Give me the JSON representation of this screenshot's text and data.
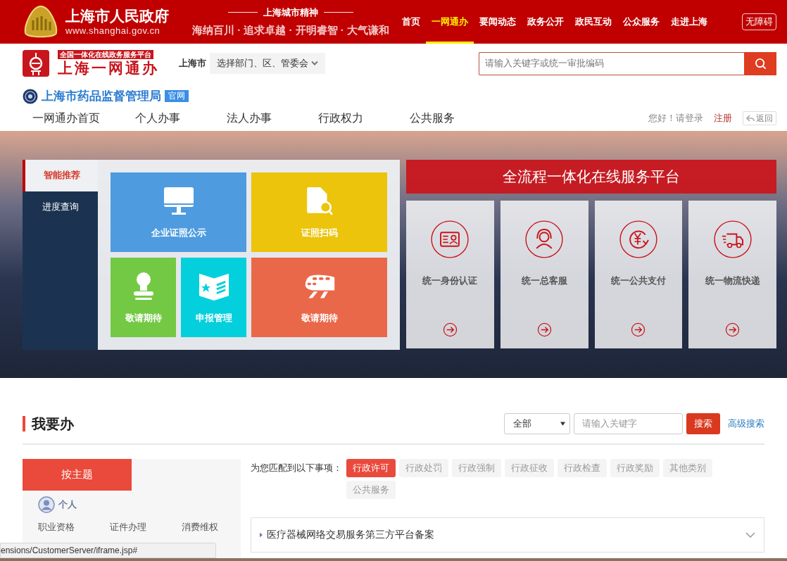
{
  "top_bar": {
    "site_title": "上海市人民政府",
    "site_url": "www.shanghai.gov.cn",
    "motto_title": "上海城市精神",
    "motto": "海纳百川 · 追求卓越 · 开明睿智 · 大气谦和",
    "nav": [
      {
        "label": "首页",
        "selected": false
      },
      {
        "label": "一网通办",
        "selected": true
      },
      {
        "label": "要闻动态",
        "selected": false
      },
      {
        "label": "政务公开",
        "selected": false
      },
      {
        "label": "政民互动",
        "selected": false
      },
      {
        "label": "公众服务",
        "selected": false
      },
      {
        "label": "走进上海",
        "selected": false
      }
    ],
    "accessibility_button": "无障碍"
  },
  "portal_header": {
    "platform_badge": "全国一体化在线政务服务平台",
    "platform_name": "上海一网通办",
    "city_label": "上海市",
    "department_select": "选择部门、区、管委会",
    "search": {
      "placeholder": "请输入关键字或统一审批编码"
    }
  },
  "agency": {
    "name": "上海市药品监督管理局",
    "badge": "官网"
  },
  "main_nav": {
    "items": [
      {
        "label": "一网通办首页",
        "selected": false
      },
      {
        "label": "个人办事",
        "selected": false
      },
      {
        "label": "法人办事",
        "selected": false
      },
      {
        "label": "行政权力",
        "selected": false
      },
      {
        "label": "公共服务",
        "selected": false
      }
    ],
    "greeting": "您好！请登录",
    "register": "注册",
    "back": "返回"
  },
  "hero": {
    "side_tabs": [
      {
        "label": "智能推荐",
        "selected": true
      },
      {
        "label": "进度查询",
        "selected": false
      }
    ],
    "tiles": [
      {
        "label": "企业证照公示",
        "color": "#4e9be0"
      },
      {
        "label": "证照扫码",
        "color": "#ebc40b"
      },
      {
        "label": "敬请期待",
        "color": "#74c944"
      },
      {
        "label": "申报管理",
        "color": "#03d0dc"
      },
      {
        "label": "敬请期待",
        "color": "#e9684a"
      }
    ],
    "banner_title": "全流程一体化在线服务平台",
    "services": [
      {
        "label": "统一身份认证"
      },
      {
        "label": "统一总客服"
      },
      {
        "label": "统一公共支付"
      },
      {
        "label": "统一物流快递"
      }
    ]
  },
  "todo": {
    "title": "我要办",
    "scope_select": "全部",
    "search": {
      "placeholder": "请输入关键字"
    },
    "search_button": "搜索",
    "advanced_search": "高级搜索",
    "theme_tab": "按主题",
    "group_label": "个人",
    "topics": [
      "职业资格",
      "证件办理",
      "消费维权"
    ],
    "matched_label": "为您匹配到以下事项：",
    "categories": [
      {
        "label": "行政许可",
        "selected": true
      },
      {
        "label": "行政处罚",
        "selected": false
      },
      {
        "label": "行政强制",
        "selected": false
      },
      {
        "label": "行政征收",
        "selected": false
      },
      {
        "label": "行政检查",
        "selected": false
      },
      {
        "label": "行政奖励",
        "selected": false
      },
      {
        "label": "其他类别",
        "selected": false
      },
      {
        "label": "公共服务",
        "selected": false
      }
    ],
    "results": [
      {
        "title": "医疗器械网络交易服务第三方平台备案",
        "expanded": false
      }
    ]
  },
  "status_bar": {
    "url": "ensions/CustomerServer/iframe.jsp#"
  }
}
